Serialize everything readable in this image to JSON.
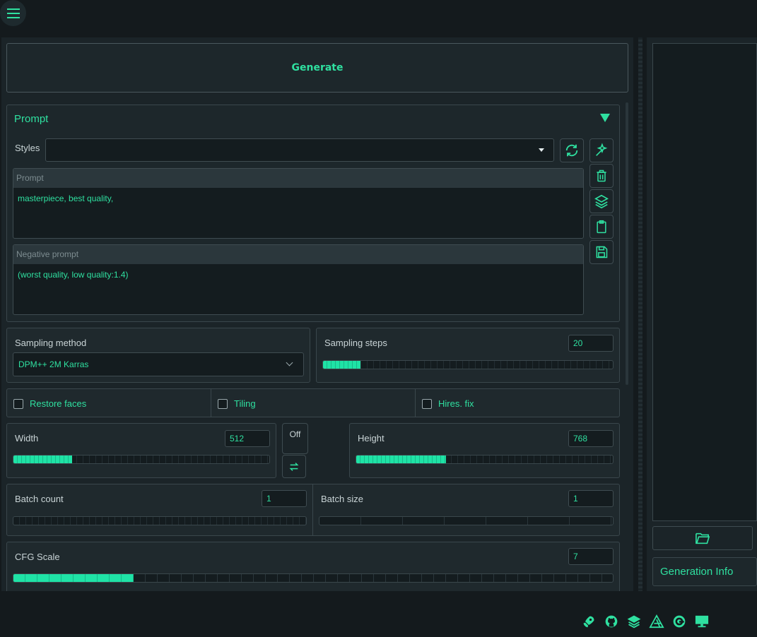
{
  "header": {
    "menu_icon": "hamburger-icon"
  },
  "generate_button": {
    "label": "Generate"
  },
  "prompt_section": {
    "title": "Prompt",
    "styles_label": "Styles",
    "styles_value": "",
    "prompt": {
      "header": "Prompt",
      "value": "masterpiece, best quality,"
    },
    "negative_prompt": {
      "header": "Negative prompt",
      "value": "(worst quality, low quality:1.4)"
    },
    "tool_icons": [
      "refresh-icon",
      "magic-wand-icon",
      "trash-icon",
      "layers-icon",
      "clipboard-icon",
      "save-icon"
    ]
  },
  "sampling": {
    "method_label": "Sampling method",
    "method_value": "DPM++ 2M Karras",
    "steps_label": "Sampling steps",
    "steps_value": "20",
    "steps_fraction": 0.13
  },
  "checkboxes": [
    {
      "label": "Restore faces",
      "checked": false
    },
    {
      "label": "Tiling",
      "checked": false
    },
    {
      "label": "Hires. fix",
      "checked": false
    }
  ],
  "dimensions": {
    "width_label": "Width",
    "width_value": "512",
    "width_fraction": 0.23,
    "height_label": "Height",
    "height_value": "768",
    "height_fraction": 0.35,
    "off_label": "Off",
    "swap_icon": "swap-arrows-icon"
  },
  "batch": {
    "count_label": "Batch count",
    "count_value": "1",
    "count_fraction": 0.0,
    "size_label": "Batch size",
    "size_value": "1",
    "size_fraction": 0.0
  },
  "cfg": {
    "label": "CFG Scale",
    "value": "7",
    "fraction": 0.2
  },
  "right_panel": {
    "folder_icon": "folder-open-icon",
    "generation_info_label": "Generation Info"
  },
  "footer": {
    "icons": [
      "rocket-icon",
      "github-icon",
      "layers-icon",
      "triangle-icon",
      "circle-logo-icon",
      "monitor-icon"
    ]
  },
  "colors": {
    "accent": "#2fe0a0",
    "background": "#141a1d",
    "panel": "#1f292d"
  }
}
